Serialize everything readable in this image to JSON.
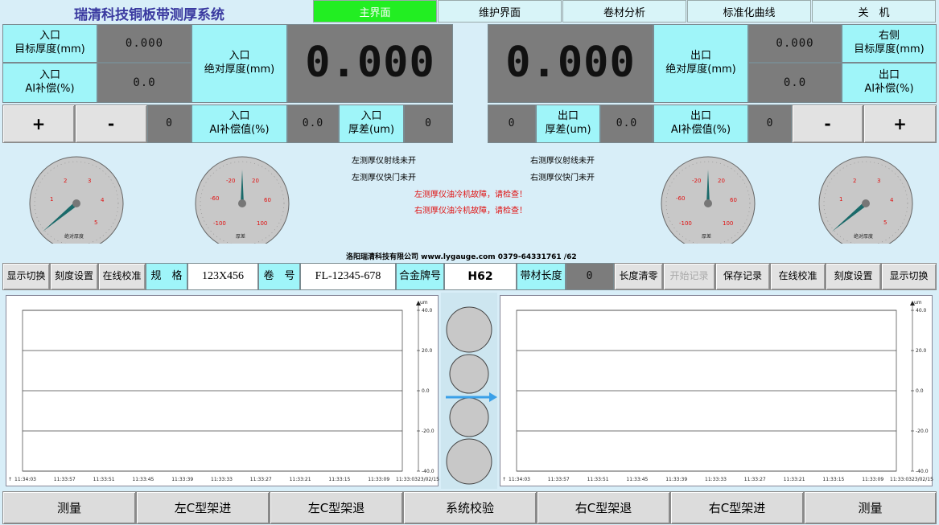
{
  "app": {
    "title": "瑞清科技铜板带测厚系统"
  },
  "tabs": [
    {
      "label": "主界面"
    },
    {
      "label": "维护界面"
    },
    {
      "label": "卷材分析"
    },
    {
      "label": "标准化曲线"
    },
    {
      "label": "关　机"
    }
  ],
  "left": {
    "target_label": "入口\n目标厚度(mm)",
    "target_value": "0.000",
    "ai_label": "入口\nAI补偿(%)",
    "ai_value": "0.0",
    "abs_label": "入口\n绝对厚度(mm)",
    "abs_value": "0.000",
    "plus": "+",
    "minus": "-",
    "step_value": "0",
    "ai_comp_label": "入口\nAI补偿值(%)",
    "ai_comp_value": "0.0",
    "diff_label": "入口\n厚差(um)",
    "diff_value": "0"
  },
  "right": {
    "target_label": "右侧\n目标厚度(mm)",
    "target_value": "0.000",
    "ai_label": "出口\nAI补偿(%)",
    "ai_value": "0.0",
    "abs_label": "出口\n绝对厚度(mm)",
    "abs_value": "0.000",
    "plus": "+",
    "minus": "-",
    "step_value": "0",
    "ai_comp_label": "出口\nAI补偿值(%)",
    "ai_comp_value": "0.0",
    "diff_label": "出口\n厚差(um)",
    "diff_value": "0",
    "diff_left_value": "0"
  },
  "gauges": {
    "abs_ticks": [
      "1",
      "2",
      "3",
      "4",
      "5"
    ],
    "abs_label": "绝对厚度",
    "diff_ticks": [
      "-100",
      "-60",
      "-20",
      "20",
      "60",
      "100"
    ],
    "diff_label": "厚差"
  },
  "messages": {
    "left_ray": "左测厚仪射线未开",
    "left_shutter": "左测厚仪快门未开",
    "right_ray": "右测厚仪射线未开",
    "right_shutter": "右测厚仪快门未开",
    "left_fault": "左测厚仪油冷机故障，请检查！",
    "right_fault": "右测厚仪油冷机故障，请检查！",
    "company": "洛阳瑞清科技有限公司 www.lygauge.com 0379-64331761 /62"
  },
  "infobar": {
    "display_switch": "显示切换",
    "scale_setting": "刻度设置",
    "online_calib": "在线校准",
    "spec_label": "规　格",
    "spec_value": "123X456",
    "coil_label": "卷　号",
    "coil_value": "FL-12345-678",
    "alloy_label": "合金牌号",
    "alloy_value": "H62",
    "length_label": "带材长度",
    "length_value": "0",
    "length_reset": "长度清零",
    "start_record": "开始记录",
    "save_record": "保存记录"
  },
  "chart": {
    "unit": "um",
    "y_ticks": [
      "40.0",
      "20.0",
      "0.0",
      "-20.0",
      "-40.0"
    ],
    "x_ticks": [
      "11:34:03",
      "11:33:57",
      "11:33:51",
      "11:33:45",
      "11:33:39",
      "11:33:33",
      "11:33:27",
      "11:33:21",
      "11:33:15",
      "11:33:09",
      "11:33:0323/02/15"
    ]
  },
  "bottom": [
    "测量",
    "左C型架进",
    "左C型架退",
    "系统校验",
    "右C型架退",
    "右C型架进",
    "测量"
  ],
  "colors": {
    "cyan": "#9ff5f9",
    "active_tab": "#22ee22",
    "background": "#d8eef8",
    "panel_gray": "#7c7c7c",
    "alarm_red": "#e01010",
    "arrow_blue": "#3aa0e8"
  }
}
